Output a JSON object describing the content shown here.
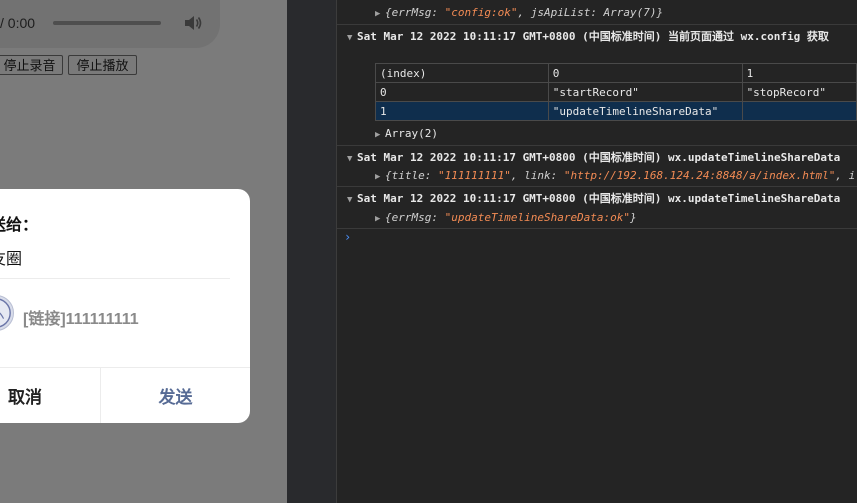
{
  "preview": {
    "audio_time": "/ 0:00",
    "buttons": {
      "stop_record": "停止录音",
      "stop_play": "停止播放"
    },
    "dialog": {
      "title": "送给：",
      "target": "友圈",
      "link_text": "[链接]111111111",
      "cancel": "取消",
      "send": "发送"
    }
  },
  "console": {
    "entries": [
      {
        "id": "config",
        "text": "{errMsg: \"config:ok\", jsApiList: Array(7)}"
      },
      {
        "id": "check",
        "header": "Sat Mar 12 2022 10:11:17 GMT+0800 (中国标准时间) 当前页面通过 wx.config 获取"
      },
      {
        "id": "timeline1",
        "header": "Sat Mar 12 2022 10:11:17 GMT+0800 (中国标准时间) wx.updateTimelineShareData"
      },
      {
        "id": "timeline1-body",
        "text": "{title: \"111111111\", link: \"http://192.168.124.24:8848/a/index.html\", i"
      },
      {
        "id": "timeline2",
        "header": "Sat Mar 12 2022 10:11:17 GMT+0800 (中国标准时间) wx.updateTimelineShareData"
      },
      {
        "id": "timeline2-body",
        "text": "{errMsg: \"updateTimelineShareData:ok\"}"
      }
    ],
    "table": {
      "headers": [
        "(index)",
        "0",
        "1"
      ],
      "rows": [
        [
          "0",
          "\"startRecord\"",
          "\"stopRecord\""
        ],
        [
          "1",
          "\"updateTimelineShareData\"",
          ""
        ]
      ]
    },
    "array_summary": "Array(2)",
    "prompt": "›"
  },
  "colors": {
    "string": "#f28b54",
    "send_button": "#576b95",
    "selected_row": "#0f2e4d"
  }
}
